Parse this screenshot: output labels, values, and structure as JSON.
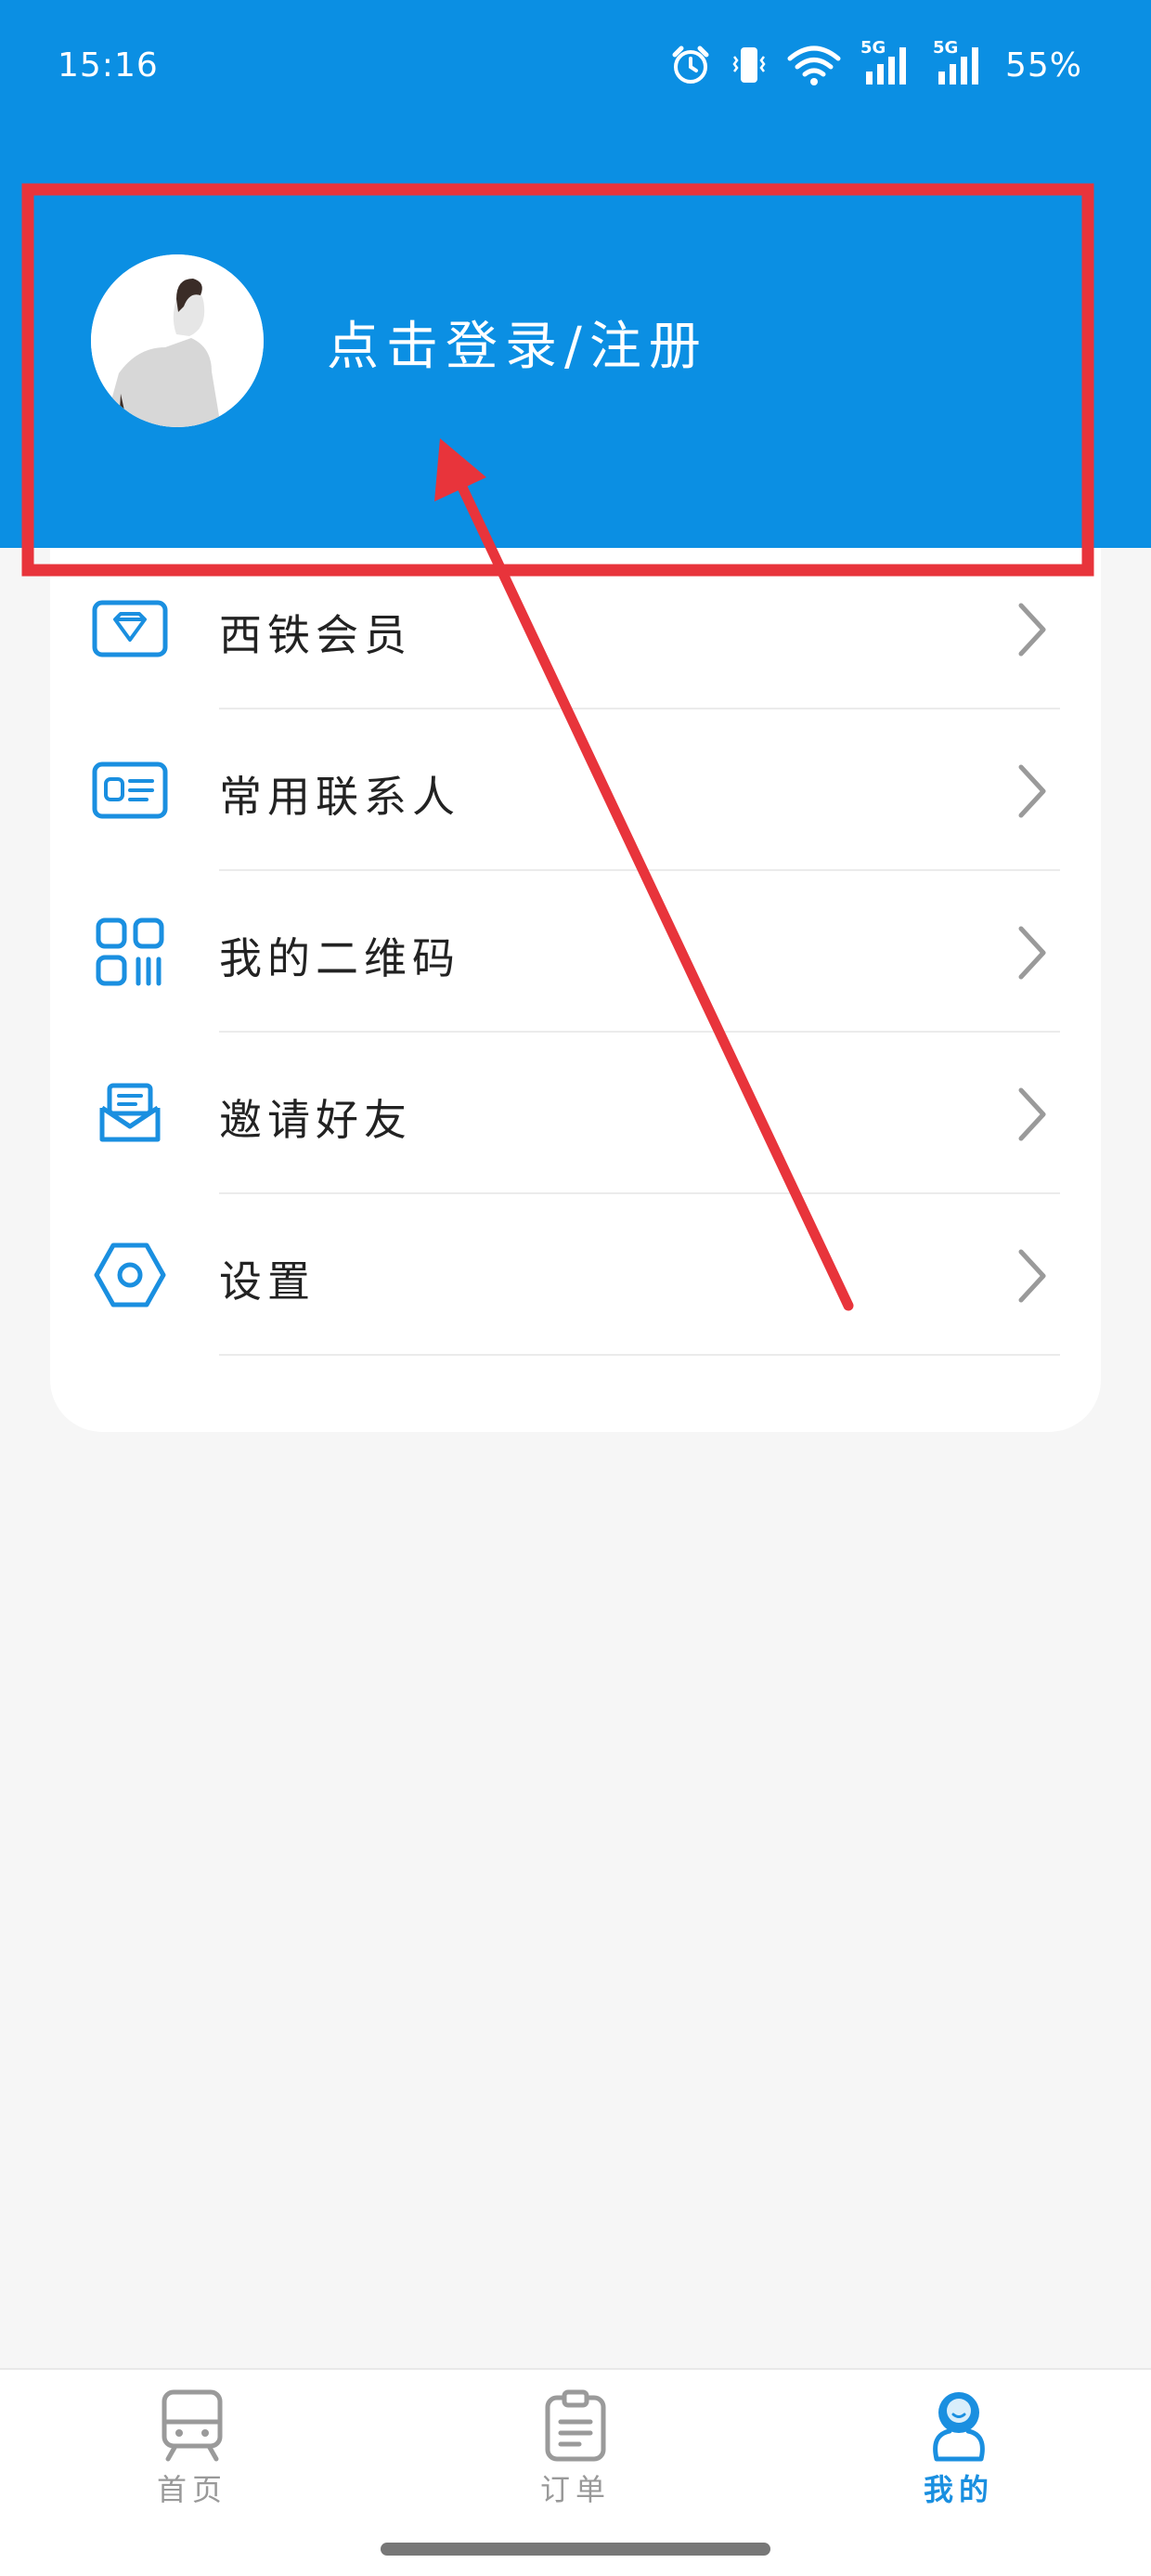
{
  "status_bar": {
    "time": "15:16",
    "network_1": "5G",
    "network_2": "5G",
    "battery": "55%"
  },
  "profile": {
    "login_label": "点击登录/注册"
  },
  "menu": {
    "items": [
      {
        "label": "西铁会员",
        "icon": "diamond-icon"
      },
      {
        "label": "常用联系人",
        "icon": "contact-card-icon"
      },
      {
        "label": "我的二维码",
        "icon": "qr-code-icon"
      },
      {
        "label": "邀请好友",
        "icon": "invite-mail-icon"
      },
      {
        "label": "设置",
        "icon": "settings-hex-icon"
      }
    ]
  },
  "bottom_nav": {
    "items": [
      {
        "label": "首页",
        "icon": "train-icon",
        "active": false
      },
      {
        "label": "订单",
        "icon": "clipboard-icon",
        "active": false
      },
      {
        "label": "我的",
        "icon": "user-icon",
        "active": true
      }
    ]
  },
  "colors": {
    "primary": "#0b8fe3",
    "accent_icon": "#1a8fe0",
    "annotation": "#e8343b",
    "page_bg": "#f6f6f6"
  }
}
